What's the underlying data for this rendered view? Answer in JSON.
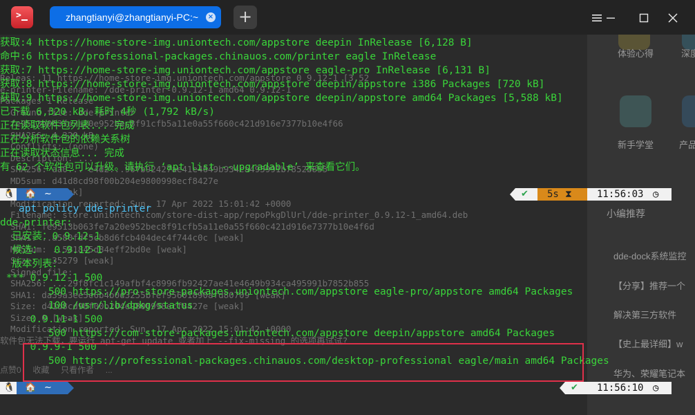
{
  "window": {
    "tab_title": "zhangtianyi@zhangtianyi-PC:~",
    "tab_close_icon": "×",
    "new_tab_icon": "+"
  },
  "background_page": {
    "lines": [
      "Releas: 11 https://home-store-img.uniontech.com/appstore 0 9.12-1 [3,52",
      "e-printer-Filename: /dde-printer-0.9.12-1 amd64 0.9.12-1",
      "Packages 1 Release",
      "  Ground file: dde-printer",
      "  fe9513b063fe7a20e952bec8f91cfb5a11e0a55f660c421d916e7377b10e4f66",
      "  SHA256: 4,320 kB,  ...",
      "  Conflicts: (none)",
      "  Description: ...",
      "  SHA256: aa0... e4d2...96fb92427ae41e4649b934ca495991b7852b855",
      "  MD5sum: d41d8cd98f00b204e9800998ecf8427e",
      "  Size: 9 [weak]",
      "  Modification reported: Sun, 17 Apr 2022 15:01:42 +0000",
      "  Filename: store.uniontech.com/store-dist-app/repoPkgDlUrl/dde-printer_0.9.12-1_amd64.deb",
      "  SHA1: fe9513b063fe7a20e952bec8f91cfb5a11e0a55f660c421d916e7377b10e4f6d",
      "  SHA1: ..a580fdf5cb8d6fcb404dec4f744c0c [weak]",
      "  MD5Sum: ..581845d84eff2bd0e [weak]",
      "  Size: ..35279 [weak]",
      "  Signed file:",
      "  SHA256: ...29f8fc1c149afbf4c8996fb92427ae41e4649b934ca495991b7852b855",
      "  SHA1: da39a3ee5e6b4b0d3255bfef95601890afd80709 [weak]",
      "  Size: d41d8cd98f00b204e9800998ecf8427e [weak]",
      "  Size: 0 [weak]",
      "  Modification reported: Sun, 17 Apr 2022 15:01:42 +0000",
      "软件包无法下载，要运行 apt-get update 或者加上 --fix-missing 的选项再试试?"
    ],
    "actions": [
      "点赞0",
      "收藏",
      "只看作者",
      "..."
    ],
    "side": {
      "item1": "体验心得",
      "item2": "深度",
      "item3": "新手学堂",
      "item4": "产品",
      "recommend": "小编推荐",
      "links": [
        "dde-dock系统监控",
        "【分享】推荐一个",
        "解决第三方软件",
        "【史上最详细】w",
        "华为、荣耀笔记本"
      ]
    }
  },
  "terminal": {
    "lines_top": [
      "获取:4 https://home-store-img.uniontech.com/appstore deepin InRelease [6,128 B]",
      "命中:6 https://professional-packages.chinauos.com/printer eagle InRelease",
      "获取:7 https://home-store-img.uniontech.com/appstore eagle-pro InRelease [6,131 B]",
      "获取:8 https://home-store-img.uniontech.com/appstore deepin/appstore i386 Packages [720 kB]",
      "获取:9 https://home-store-img.uniontech.com/appstore deepin/appstore amd64 Packages [5,588 kB]",
      "已下载 6,320 kB，耗时 4秒 (1,792 kB/s)",
      "正在读取软件包列表... 完成",
      "正在分析软件包的依赖关系树",
      "正在读取状态信息... 完成",
      "有 62 个软件包可以升级。请执行 ‘apt list --upgradable’ 来查看它们。"
    ],
    "prompt1": {
      "tux": "🐧",
      "home_icon": "🏠",
      "path": "~",
      "check": "✔",
      "duration": "5s",
      "hourglass": "⧗",
      "time": "11:56:03",
      "clock_icon": "◷"
    },
    "command": "apt policy dde-printer",
    "policy_lines": [
      "dde-printer:",
      "  已安装：0.9.12-1",
      "  候选：  0.9.12-1",
      "  版本列表：",
      " *** 0.9.12-1 500",
      "        500 https://pro-store-packages.uniontech.com/appstore eagle-pro/appstore amd64 Packages",
      "        100 /usr/lib/dpkg/status",
      "     0.9.11-1 500",
      "        500 https://com-store-packages.uniontech.com/appstore deepin/appstore amd64 Packages",
      "     0.9.9-1 500",
      "        500 https://professional-packages.chinauos.com/desktop-professional eagle/main amd64 Packages"
    ],
    "prompt2": {
      "tux": "🐧",
      "home_icon": "🏠",
      "path": "~",
      "check": "✔",
      "time": "11:56:10",
      "clock_icon": "◷"
    }
  },
  "colors": {
    "terminal_text": "#3ad53a",
    "command_text": "#4fc3f7",
    "tab_active": "#0d6ee6",
    "highlight_box": "#e0304a",
    "duration_segment": "#d9891a"
  }
}
